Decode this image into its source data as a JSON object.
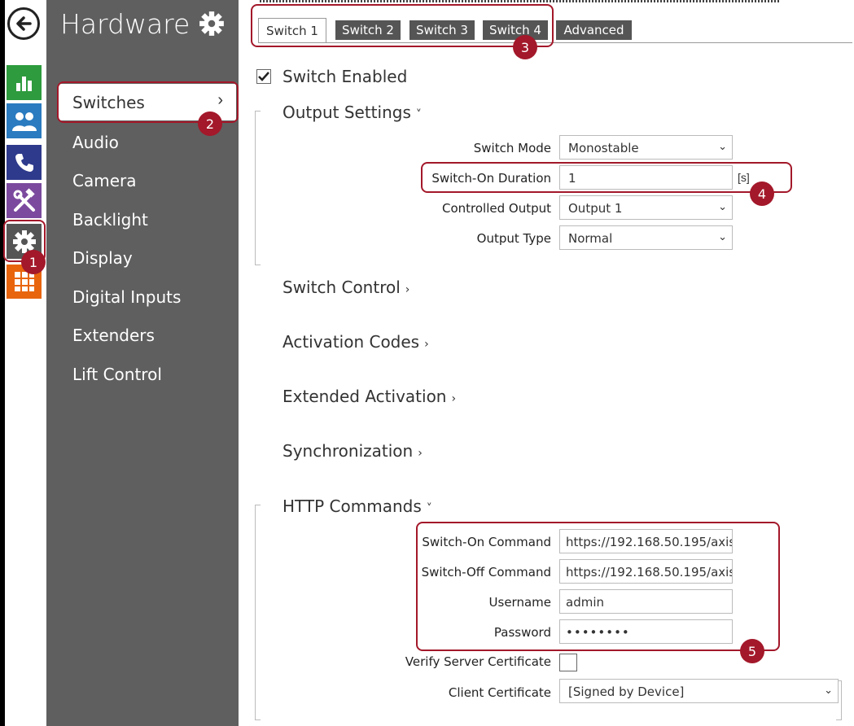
{
  "sidebar": {
    "title": "Hardware",
    "items": [
      {
        "label": "Switches",
        "active": true
      },
      {
        "label": "Audio"
      },
      {
        "label": "Camera"
      },
      {
        "label": "Backlight"
      },
      {
        "label": "Display"
      },
      {
        "label": "Digital Inputs"
      },
      {
        "label": "Extenders"
      },
      {
        "label": "Lift Control"
      }
    ],
    "chevron": "›"
  },
  "leftbar": {
    "icons": [
      "back-arrow-icon",
      "bar-chart-icon",
      "users-icon",
      "phone-icon",
      "tools-icon",
      "gear-icon",
      "grid-icon"
    ],
    "colors": {
      "green": "#2e9b3e",
      "blue": "#2a7bc0",
      "navy": "#2e3a8c",
      "purple": "#7b4a9e",
      "gray": "#555555",
      "orange": "#e8650e"
    }
  },
  "tabs": [
    {
      "label": "Switch 1",
      "active": true
    },
    {
      "label": "Switch 2"
    },
    {
      "label": "Switch 3"
    },
    {
      "label": "Switch 4"
    },
    {
      "label": "Advanced"
    }
  ],
  "switch_enabled": {
    "label": "Switch Enabled",
    "checked": true
  },
  "output_settings": {
    "title": "Output Settings",
    "chevron": "˅",
    "switch_mode": {
      "label": "Switch Mode",
      "value": "Monostable"
    },
    "switch_on_duration": {
      "label": "Switch-On Duration",
      "value": "1",
      "unit": "[s]"
    },
    "controlled_output": {
      "label": "Controlled Output",
      "value": "Output 1"
    },
    "output_type": {
      "label": "Output Type",
      "value": "Normal"
    }
  },
  "collapsed_sections": [
    {
      "title": "Switch Control",
      "chevron": "›"
    },
    {
      "title": "Activation Codes",
      "chevron": "›"
    },
    {
      "title": "Extended Activation",
      "chevron": "›"
    },
    {
      "title": "Synchronization",
      "chevron": "›"
    }
  ],
  "http_commands": {
    "title": "HTTP Commands",
    "chevron": "˅",
    "switch_on_command": {
      "label": "Switch-On Command",
      "value": "https://192.168.50.195/axis"
    },
    "switch_off_command": {
      "label": "Switch-Off Command",
      "value": "https://192.168.50.195/axis"
    },
    "username": {
      "label": "Username",
      "value": "admin"
    },
    "password": {
      "label": "Password",
      "value": "••••••••"
    },
    "verify_server_certificate": {
      "label": "Verify Server Certificate",
      "checked": false
    },
    "client_certificate": {
      "label": "Client Certificate",
      "value": "[Signed by Device]"
    }
  },
  "annotations": [
    "1",
    "2",
    "3",
    "4",
    "5"
  ],
  "accent_color": "#a3182a",
  "caret": "⌄"
}
